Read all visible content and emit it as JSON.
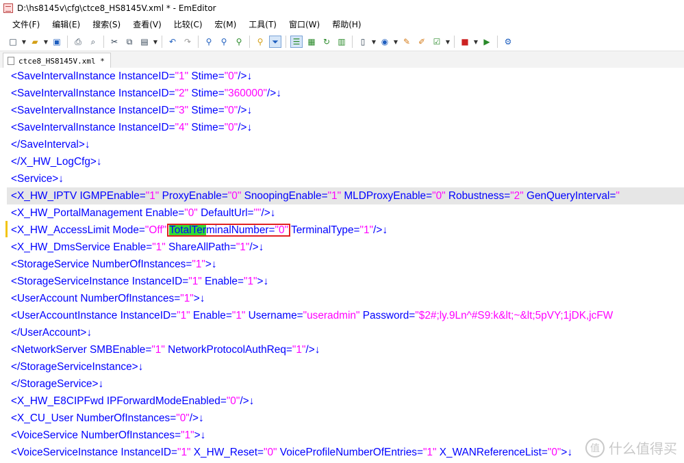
{
  "window": {
    "title": "D:\\hs8145v\\cfg\\ctce8_HS8145V.xml * - EmEditor"
  },
  "menu": [
    "文件(F)",
    "编辑(E)",
    "搜索(S)",
    "查看(V)",
    "比较(C)",
    "宏(M)",
    "工具(T)",
    "窗口(W)",
    "帮助(H)"
  ],
  "tab": {
    "label": "ctce8_HS8145V.xml *"
  },
  "eol_mark": "↓",
  "lines": [
    {
      "tag": "<SaveIntervalInstance",
      "attrs": [
        {
          "name": "InstanceID",
          "value": "\"1\""
        },
        {
          "name": "Stime",
          "value": "\"0\""
        }
      ],
      "close": "/>"
    },
    {
      "tag": "<SaveIntervalInstance",
      "attrs": [
        {
          "name": "InstanceID",
          "value": "\"2\""
        },
        {
          "name": "Stime",
          "value": "\"360000\""
        }
      ],
      "close": "/>"
    },
    {
      "tag": "<SaveIntervalInstance",
      "attrs": [
        {
          "name": "InstanceID",
          "value": "\"3\""
        },
        {
          "name": "Stime",
          "value": "\"0\""
        }
      ],
      "close": "/>"
    },
    {
      "tag": "<SaveIntervalInstance",
      "attrs": [
        {
          "name": "InstanceID",
          "value": "\"4\""
        },
        {
          "name": "Stime",
          "value": "\"0\""
        }
      ],
      "close": "/>"
    },
    {
      "tag": "</SaveInterval>",
      "attrs": [],
      "close": ""
    },
    {
      "tag": "</X_HW_LogCfg>",
      "attrs": [],
      "close": ""
    },
    {
      "tag": "<Service>",
      "attrs": [],
      "close": ""
    },
    {
      "tag": "<X_HW_IPTV",
      "attrs": [
        {
          "name": "IGMPEnable",
          "value": "\"1\""
        },
        {
          "name": "ProxyEnable",
          "value": "\"0\""
        },
        {
          "name": "SnoopingEnable",
          "value": "\"1\""
        },
        {
          "name": "MLDProxyEnable",
          "value": "\"0\""
        },
        {
          "name": "Robustness",
          "value": "\"2\""
        },
        {
          "name": "GenQueryInterval",
          "value": "\""
        }
      ],
      "close": "",
      "noeol": true
    },
    {
      "tag": "<X_HW_PortalManagement",
      "attrs": [
        {
          "name": "Enable",
          "value": "\"0\""
        },
        {
          "name": "DefaultUrl",
          "value": "\"\""
        }
      ],
      "close": "/>"
    },
    {
      "tag": "<X_HW_AccessLimit",
      "attrs": [
        {
          "name": "Mode",
          "value": "\"Off\""
        },
        {
          "name": "TotalTerminalNumber",
          "value": "\"0\"",
          "hl": "TotalTer",
          "rest": "minalNumber"
        },
        {
          "name": "TerminalType",
          "value": "\"1\""
        }
      ],
      "close": "/>"
    },
    {
      "tag": "<X_HW_DmsService",
      "attrs": [
        {
          "name": "Enable",
          "value": "\"1\""
        },
        {
          "name": "ShareAllPath",
          "value": "\"1\""
        }
      ],
      "close": "/>"
    },
    {
      "tag": "<StorageService",
      "attrs": [
        {
          "name": "NumberOfInstances",
          "value": "\"1\""
        }
      ],
      "close": ">"
    },
    {
      "tag": "<StorageServiceInstance",
      "attrs": [
        {
          "name": "InstanceID",
          "value": "\"1\""
        },
        {
          "name": "Enable",
          "value": "\"1\""
        }
      ],
      "close": ">"
    },
    {
      "tag": "<UserAccount",
      "attrs": [
        {
          "name": "NumberOfInstances",
          "value": "\"1\""
        }
      ],
      "close": ">"
    },
    {
      "tag": "<UserAccountInstance",
      "attrs": [
        {
          "name": "InstanceID",
          "value": "\"1\""
        },
        {
          "name": "Enable",
          "value": "\"1\""
        },
        {
          "name": "Username",
          "value": "\"useradmin\""
        },
        {
          "name": "Password",
          "value": "\"$2#;ly.9Ln^#S9:k&lt;~&lt;5pVY;1jDK,jcFW"
        }
      ],
      "close": "",
      "noeol": true
    },
    {
      "tag": "</UserAccount>",
      "attrs": [],
      "close": ""
    },
    {
      "tag": "<NetworkServer",
      "attrs": [
        {
          "name": "SMBEnable",
          "value": "\"1\""
        },
        {
          "name": "NetworkProtocolAuthReq",
          "value": "\"1\""
        }
      ],
      "close": "/>"
    },
    {
      "tag": "</StorageServiceInstance>",
      "attrs": [],
      "close": ""
    },
    {
      "tag": "</StorageService>",
      "attrs": [],
      "close": ""
    },
    {
      "tag": "<X_HW_E8CIPFwd",
      "attrs": [
        {
          "name": "IPForwardModeEnabled",
          "value": "\"0\""
        }
      ],
      "close": "/>"
    },
    {
      "tag": "<X_CU_User",
      "attrs": [
        {
          "name": "NumberOfInstances",
          "value": "\"0\""
        }
      ],
      "close": "/>"
    },
    {
      "tag": "<VoiceService",
      "attrs": [
        {
          "name": "NumberOfInstances",
          "value": "\"1\""
        }
      ],
      "close": ">"
    },
    {
      "tag": "<VoiceServiceInstance",
      "attrs": [
        {
          "name": "InstanceID",
          "value": "\"1\""
        },
        {
          "name": "X_HW_Reset",
          "value": "\"0\""
        },
        {
          "name": "VoiceProfileNumberOfEntries",
          "value": "\"1\""
        },
        {
          "name": "X_WANReferenceList",
          "value": "\"0\""
        }
      ],
      "close": ">"
    }
  ],
  "watermark": {
    "icon": "值",
    "text": "什么值得买"
  },
  "colors": {
    "tag": "#0000ff",
    "value": "#ff00ff",
    "highlight": "#33dd33",
    "box": "#e02020",
    "current_line": "#e6e6e6"
  }
}
